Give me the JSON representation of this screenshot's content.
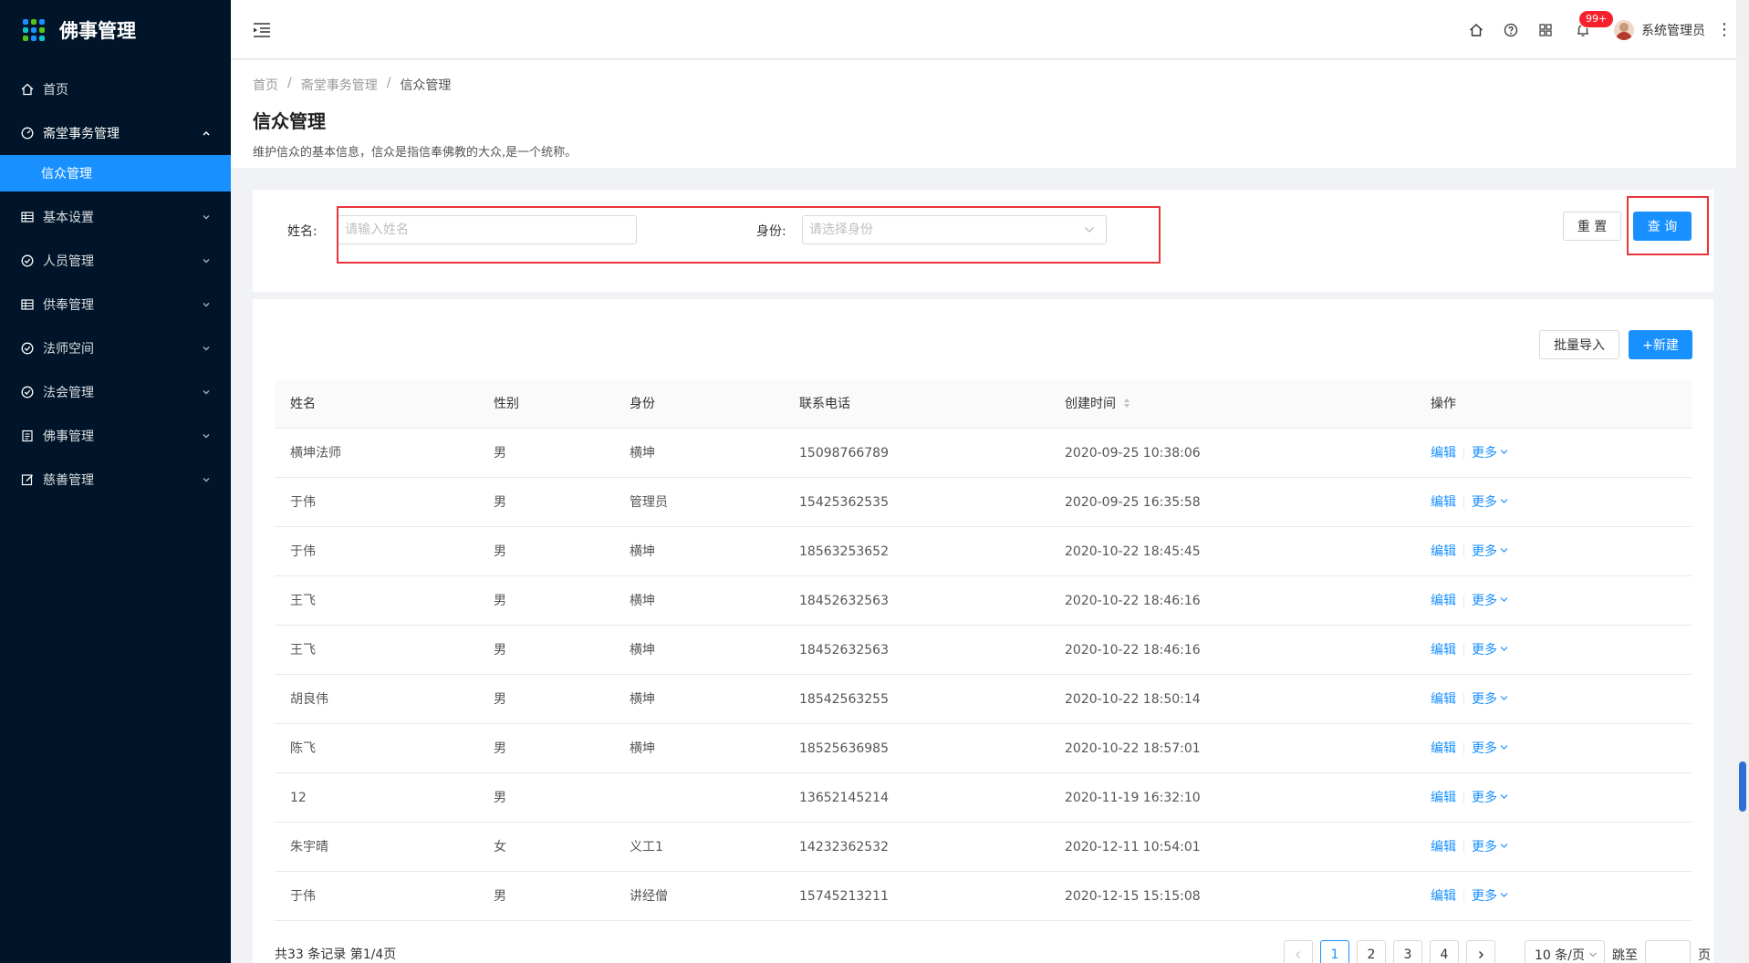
{
  "app": {
    "title": "佛事管理"
  },
  "sidebar": {
    "items": [
      {
        "label": "首页",
        "icon": "home-icon"
      },
      {
        "label": "斋堂事务管理",
        "icon": "dashboard-icon",
        "open": true
      },
      {
        "label": "信众管理",
        "selected": true
      },
      {
        "label": "基本设置",
        "icon": "table-icon"
      },
      {
        "label": "人员管理",
        "icon": "check-circle-icon"
      },
      {
        "label": "供奉管理",
        "icon": "table-icon"
      },
      {
        "label": "法师空间",
        "icon": "check-circle-icon"
      },
      {
        "label": "法会管理",
        "icon": "check-circle-icon"
      },
      {
        "label": "佛事管理",
        "icon": "profile-icon"
      },
      {
        "label": "慈善管理",
        "icon": "form-icon"
      }
    ]
  },
  "header": {
    "notification_count": "99+",
    "user_name": "系统管理员"
  },
  "breadcrumb": [
    "首页",
    "斋堂事务管理",
    "信众管理"
  ],
  "page": {
    "title": "信众管理",
    "description": "维护信众的基本信息，信众是指信奉佛教的大众,是一个统称。"
  },
  "search": {
    "name_label": "姓名:",
    "name_placeholder": "请输入姓名",
    "identity_label": "身份:",
    "identity_placeholder": "请选择身份",
    "reset_label": "重 置",
    "query_label": "查 询"
  },
  "toolbar": {
    "import_label": "批量导入",
    "new_label": "+新建"
  },
  "table": {
    "columns": [
      "姓名",
      "性别",
      "身份",
      "联系电话",
      "创建时间",
      "操作"
    ],
    "edit_label": "编辑",
    "more_label": "更多",
    "rows": [
      [
        "横坤法师",
        "男",
        "横坤",
        "15098766789",
        "2020-09-25 10:38:06"
      ],
      [
        "于伟",
        "男",
        "管理员",
        "15425362535",
        "2020-09-25 16:35:58"
      ],
      [
        "于伟",
        "男",
        "横坤",
        "18563253652",
        "2020-10-22 18:45:45"
      ],
      [
        "王飞",
        "男",
        "横坤",
        "18452632563",
        "2020-10-22 18:46:16"
      ],
      [
        "王飞",
        "男",
        "横坤",
        "18452632563",
        "2020-10-22 18:46:16"
      ],
      [
        "胡良伟",
        "男",
        "横坤",
        "18542563255",
        "2020-10-22 18:50:14"
      ],
      [
        "陈飞",
        "男",
        "横坤",
        "18525636985",
        "2020-10-22 18:57:01"
      ],
      [
        "12",
        "男",
        "",
        "13652145214",
        "2020-11-19 16:32:10"
      ],
      [
        "朱宇晴",
        "女",
        "义工1",
        "14232362532",
        "2020-12-11 10:54:01"
      ],
      [
        "于伟",
        "男",
        "讲经僧",
        "15745213211",
        "2020-12-15 15:15:08"
      ]
    ]
  },
  "pagination": {
    "total_text": "共33 条记录 第1/4页",
    "pages": [
      "1",
      "2",
      "3",
      "4"
    ],
    "current": "1",
    "page_size": "10 条/页",
    "jump_label": "跳至",
    "page_unit": "页"
  }
}
